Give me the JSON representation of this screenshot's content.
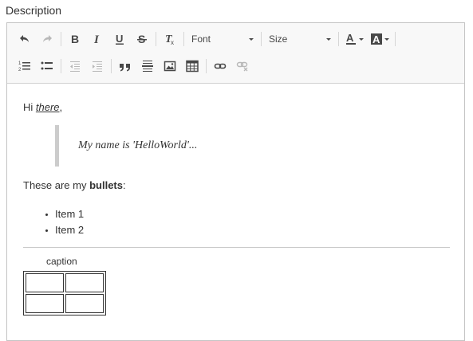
{
  "field": {
    "label": "Description"
  },
  "toolbar": {
    "font_combo": "Font",
    "size_combo": "Size"
  },
  "content": {
    "greeting_prefix": "Hi ",
    "greeting_emphasis": "there",
    "greeting_suffix": ",",
    "blockquote": "My name is 'HelloWorld'...",
    "bullets_intro_prefix": "These are my ",
    "bullets_intro_bold": "bullets",
    "bullets_intro_suffix": ":",
    "bullet_items": [
      "Item 1",
      "Item 2"
    ],
    "table_caption": "caption"
  },
  "colors": {
    "toolbar_bg": "#f8f8f8",
    "border": "#c4c4c4",
    "quote_bar": "#cccccc",
    "icon": "#484848"
  }
}
